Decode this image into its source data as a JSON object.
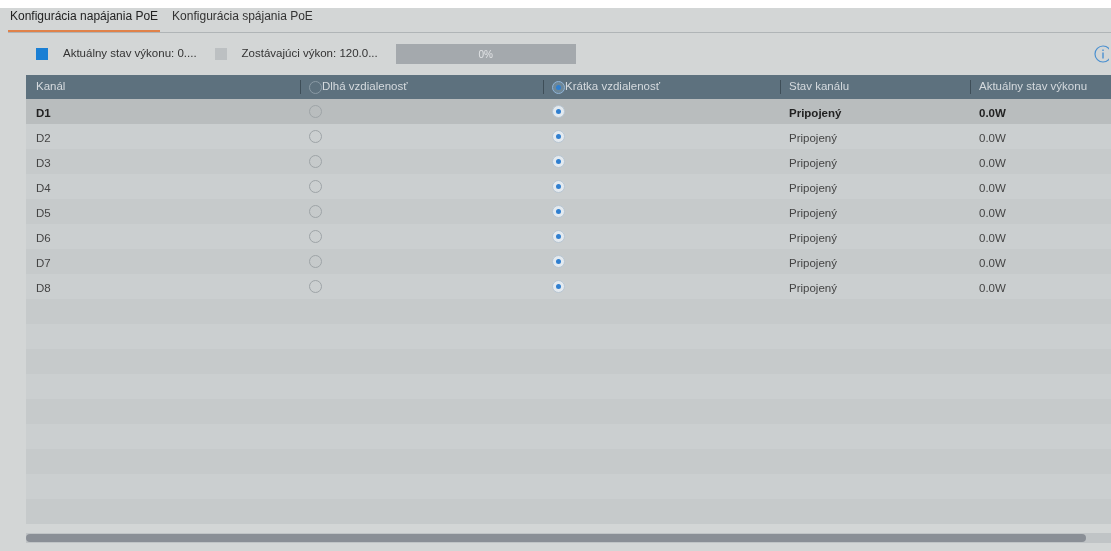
{
  "tabs": [
    {
      "label": "Konfigurácia napájania PoE",
      "selected": true
    },
    {
      "label": "Konfigurácia spájania PoE",
      "selected": false
    }
  ],
  "legend": [
    {
      "label": "Aktuálny stav výkonu: 0....",
      "color": "#1a7fd4"
    },
    {
      "label": "Zostávajúci výkon: 120.0...",
      "color": "#bcc0c2"
    }
  ],
  "power_bar": {
    "level": 0,
    "reading": "0%"
  },
  "table": {
    "columns": [
      {
        "label": "Kanál",
        "kind": "text"
      },
      {
        "label": "Dlhá vzdialenosť",
        "kind": "radio",
        "selected": false
      },
      {
        "label": "Krátka vzdialenosť",
        "kind": "radio",
        "selected": true
      },
      {
        "label": "Stav kanálu",
        "kind": "text"
      },
      {
        "label": "Aktuálny stav výkonu",
        "kind": "text"
      }
    ],
    "rows": [
      {
        "channel": "D1",
        "long_distance": false,
        "short_distance": true,
        "status": "Pripojený",
        "power": "0.0W",
        "selected": true
      },
      {
        "channel": "D2",
        "long_distance": false,
        "short_distance": true,
        "status": "Pripojený",
        "power": "0.0W",
        "selected": false
      },
      {
        "channel": "D3",
        "long_distance": false,
        "short_distance": true,
        "status": "Pripojený",
        "power": "0.0W",
        "selected": false
      },
      {
        "channel": "D4",
        "long_distance": false,
        "short_distance": true,
        "status": "Pripojený",
        "power": "0.0W",
        "selected": false
      },
      {
        "channel": "D5",
        "long_distance": false,
        "short_distance": true,
        "status": "Pripojený",
        "power": "0.0W",
        "selected": false
      },
      {
        "channel": "D6",
        "long_distance": false,
        "short_distance": true,
        "status": "Pripojený",
        "power": "0.0W",
        "selected": false
      },
      {
        "channel": "D7",
        "long_distance": false,
        "short_distance": true,
        "status": "Pripojený",
        "power": "0.0W",
        "selected": false
      },
      {
        "channel": "D8",
        "long_distance": false,
        "short_distance": true,
        "status": "Pripojený",
        "power": "0.0W",
        "selected": false
      }
    ]
  }
}
